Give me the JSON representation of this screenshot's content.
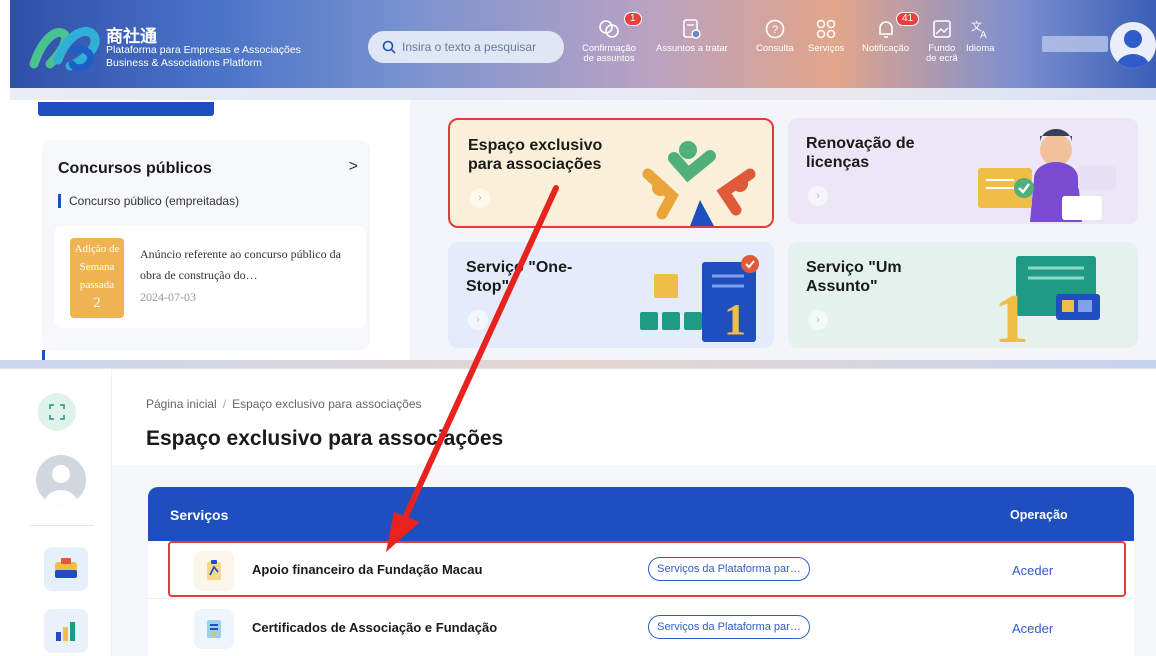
{
  "header": {
    "brand_cn": "商社通",
    "brand_pt": "Plataforma para Empresas e Associações",
    "brand_en": "Business & Associations Platform",
    "search_placeholder": "Insira o texto a pesquisar",
    "nav": [
      {
        "label_1": "Confirmação",
        "label_2": "de assuntos",
        "badge": "1"
      },
      {
        "label_1": "Assuntos a tratar",
        "label_2": ""
      },
      {
        "label_1": "Consulta",
        "label_2": ""
      },
      {
        "label_1": "Serviços",
        "label_2": ""
      },
      {
        "label_1": "Notificação",
        "label_2": "",
        "badge": "41"
      },
      {
        "label_1": "Fundo",
        "label_2": "de ecrã"
      },
      {
        "label_1": "Idioma",
        "label_2": ""
      }
    ]
  },
  "concursos": {
    "title": "Concursos públicos",
    "arrow": ">",
    "subtitle": "Concurso público (empreitadas)",
    "notice_tag_1": "Adição de",
    "notice_tag_2": "Semana",
    "notice_tag_3": "passada",
    "notice_tag_count": "2",
    "notice_text": "Anúncio referente ao concurso público da obra de construção do…",
    "notice_date": "2024-07-03"
  },
  "tiles": [
    {
      "title_1": "Espaço exclusivo",
      "title_2": "para associações"
    },
    {
      "title_1": "Renovação de",
      "title_2": "licenças"
    },
    {
      "title_1": "Serviço \"One-",
      "title_2": "Stop\""
    },
    {
      "title_1": "Serviço \"Um",
      "title_2": "Assunto\""
    }
  ],
  "bottom": {
    "breadcrumb_home": "Página inicial",
    "breadcrumb_sep": "/",
    "breadcrumb_current": "Espaço exclusivo para associações",
    "page_title": "Espaço exclusivo para associações",
    "table_head_services": "Serviços",
    "table_head_operation": "Operação",
    "rows": [
      {
        "name": "Apoio financeiro da Fundação Macau",
        "tag": "Serviços da Plataforma par…",
        "action": "Aceder"
      },
      {
        "name": "Certificados de Associação e Fundação",
        "tag": "Serviços da Plataforma par…",
        "action": "Aceder"
      }
    ]
  },
  "colors": {
    "primary": "#1f4fbf",
    "highlight": "#e23b3b",
    "notice_tag": "#efb352"
  }
}
